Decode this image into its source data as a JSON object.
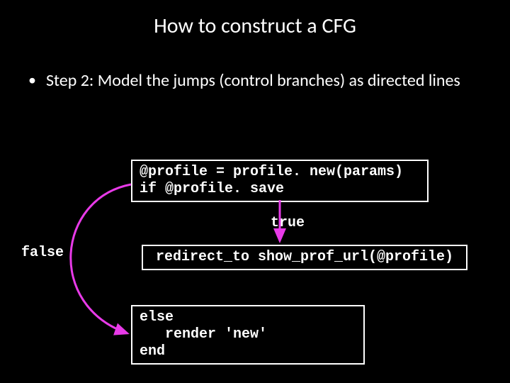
{
  "title": "How to construct a CFG",
  "bullet": {
    "text": "Step 2: Model the jumps (control branches) as directed lines"
  },
  "boxes": {
    "box1": "@profile = profile. new(params)\nif @profile. save",
    "box2": "redirect_to show_prof_url(@profile)",
    "box3": "else\n   render 'new'\nend"
  },
  "labels": {
    "true": "true",
    "false": "false"
  },
  "colors": {
    "arrow": "#e83ae8"
  }
}
